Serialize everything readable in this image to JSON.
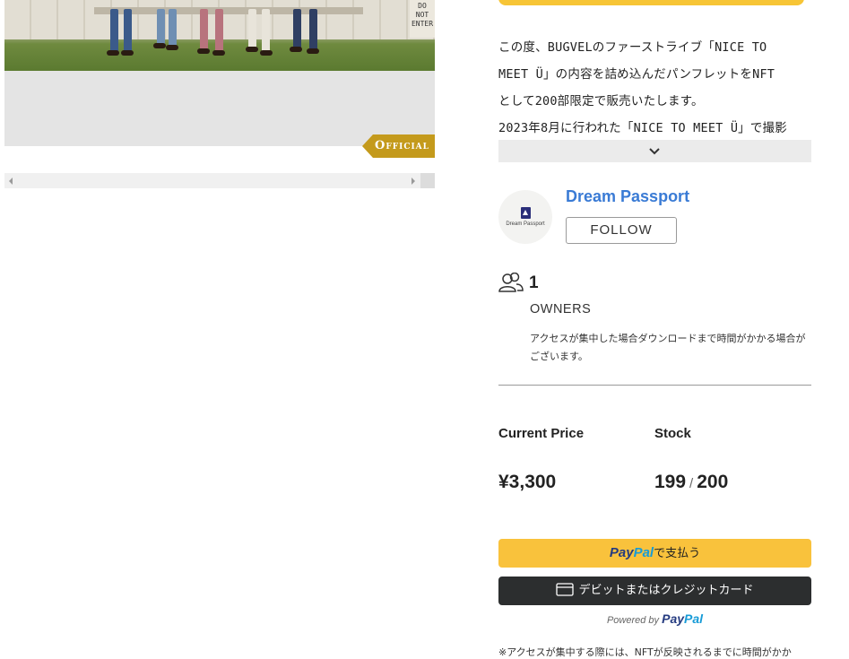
{
  "hero": {
    "sign_text": "DO\nNOT\nENTER",
    "official_badge": "Official"
  },
  "description": {
    "lines": [
      "この度、BUGVELのファーストライブ「NICE TO",
      "MEET Ü」の内容を詰め込んだパンフレットをNFT",
      "として200部限定で販売いたします。",
      "2023年8月に行われた「NICE TO MEET Ü」で撮影"
    ]
  },
  "organizer": {
    "name": "Dream Passport",
    "avatar_text": "Dream Passport",
    "follow_label": "FOLLOW"
  },
  "owners": {
    "count": "1",
    "label": "OWNERS",
    "note": "アクセスが集中した場合ダウンロードまで時間がかかる場合がございます。"
  },
  "pricing": {
    "price_label": "Current Price",
    "price_value": "¥3,300",
    "stock_label": "Stock",
    "stock_current": "199",
    "stock_total": "200"
  },
  "payment": {
    "paypal_pay": "Pay",
    "paypal_pal": "Pal",
    "paypal_suffix": "で支払う",
    "card_label": "デビットまたはクレジットカード",
    "powered_by": "Powered by"
  },
  "footnote": "※アクセスが集中する際には、NFTが反映されるまでに時間がかか",
  "colors": {
    "accent_yellow": "#f9c23c",
    "link_blue": "#3a7bd5",
    "official_gold": "#c49a1c",
    "card_button": "#2c2e2f"
  }
}
